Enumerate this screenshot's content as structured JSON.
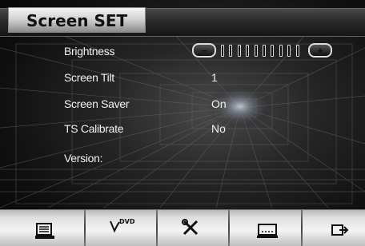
{
  "header": {
    "title": "Screen SET"
  },
  "settings": {
    "rows": [
      {
        "label": "Brightness",
        "value": ""
      },
      {
        "label": "Screen Tilt",
        "value": "1"
      },
      {
        "label": "Screen Saver",
        "value": "On"
      },
      {
        "label": "TS Calibrate",
        "value": "No"
      },
      {
        "label": "Version:",
        "value": ""
      }
    ],
    "brightness": {
      "level": 1.0,
      "steps": 10,
      "minus_icon": "minus-icon",
      "plus_icon": "plus-icon"
    }
  },
  "toolbar": {
    "items": [
      {
        "icon": "radio-icon",
        "label": ""
      },
      {
        "icon": "dvd-icon",
        "label": "DVD"
      },
      {
        "icon": "tools-icon",
        "label": ""
      },
      {
        "icon": "screen-icon",
        "label": ""
      },
      {
        "icon": "exit-icon",
        "label": ""
      }
    ]
  }
}
